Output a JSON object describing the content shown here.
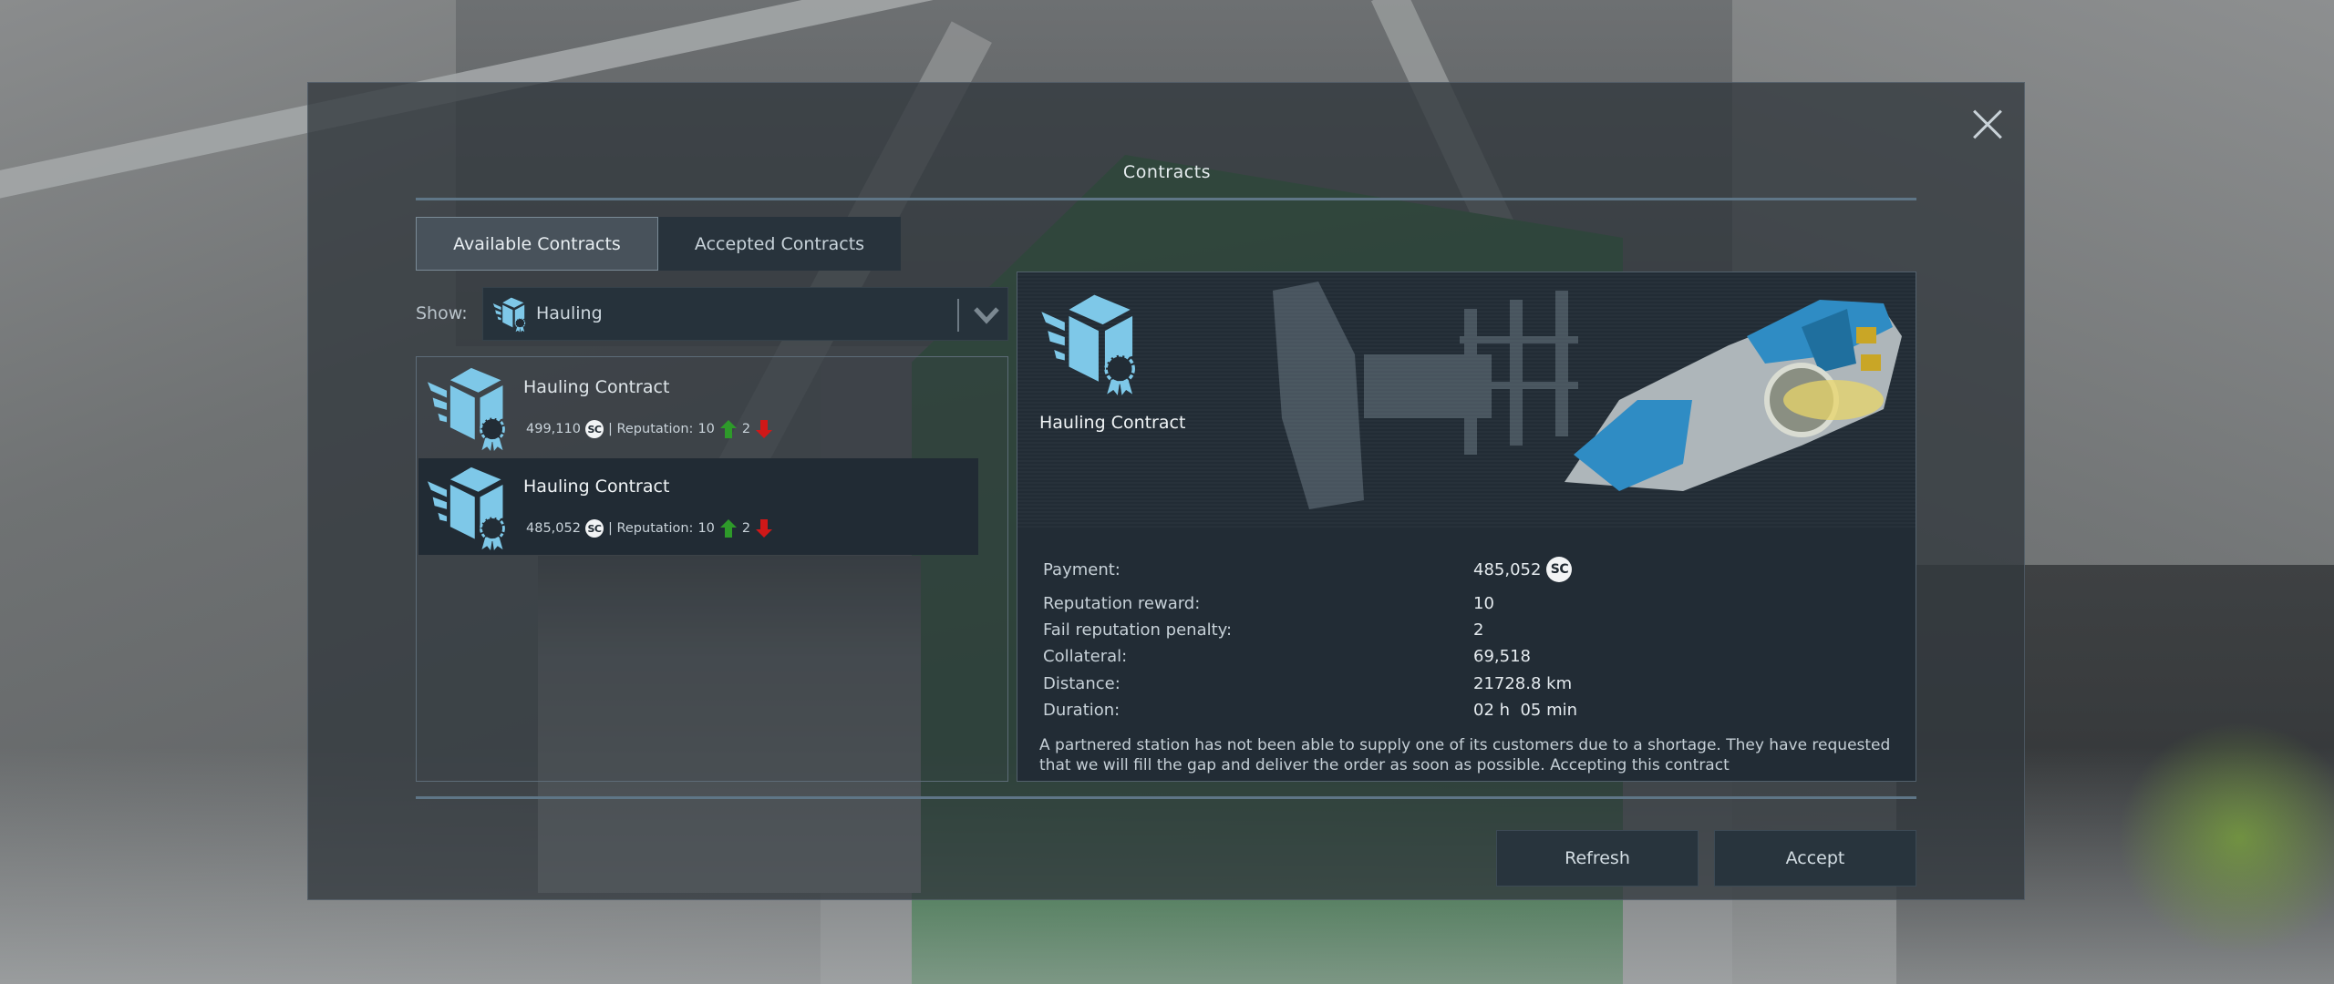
{
  "dialog": {
    "title": "Contracts",
    "close_icon": "close-icon"
  },
  "tabs": [
    {
      "label": "Available Contracts",
      "active": true
    },
    {
      "label": "Accepted Contracts",
      "active": false
    }
  ],
  "filter": {
    "label": "Show:",
    "selected": "Hauling",
    "icon": "hauling-icon"
  },
  "contracts": [
    {
      "title": "Hauling Contract",
      "payment": "499,110",
      "currency": "SC",
      "reputation_label": "| Reputation:",
      "reputation_reward": "10",
      "reputation_penalty": "2",
      "selected": false
    },
    {
      "title": "Hauling Contract",
      "payment": "485,052",
      "currency": "SC",
      "reputation_label": "| Reputation:",
      "reputation_reward": "10",
      "reputation_penalty": "2",
      "selected": true
    }
  ],
  "details": {
    "title": "Hauling Contract",
    "rows": [
      {
        "label": "Payment:",
        "value": "485,052",
        "currency": "SC"
      },
      {
        "label": "Reputation reward:",
        "value": "10"
      },
      {
        "label": "Fail reputation penalty:",
        "value": "2"
      },
      {
        "label": "Collateral:",
        "value": "69,518"
      },
      {
        "label": "Distance:",
        "value": "21728.8 km"
      },
      {
        "label": "Duration:",
        "value": "02 h  05 min"
      }
    ],
    "description": "A partnered station has not been able to supply one of its customers due to a shortage. They have requested that we will fill the gap and deliver the order as soon as possible. Accepting this contract"
  },
  "buttons": {
    "refresh": "Refresh",
    "accept": "Accept"
  },
  "colors": {
    "icon_blue": "#7ec8e8",
    "arrow_up_green": "#2e9a2a",
    "arrow_down_red": "#d01818",
    "separator": "#5f7687",
    "selected_row": "#212b34"
  }
}
